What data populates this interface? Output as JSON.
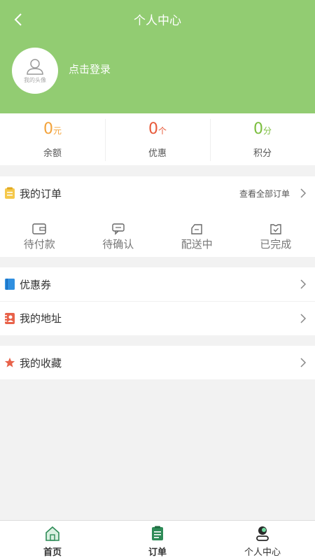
{
  "header": {
    "title": "个人中心",
    "avatar_label": "我的头像",
    "login_text": "点击登录",
    "bg_color": "#92cc72"
  },
  "stats": [
    {
      "value": "0",
      "unit": "元",
      "label": "余额",
      "color": "#f3a33b"
    },
    {
      "value": "0",
      "unit": "个",
      "label": "优惠",
      "color": "#e85a3a"
    },
    {
      "value": "0",
      "unit": "分",
      "label": "积分",
      "color": "#7cbe3f"
    }
  ],
  "orders": {
    "title": "我的订单",
    "view_all": "查看全部订单",
    "items": [
      {
        "label": "待付款",
        "icon": "wallet-icon"
      },
      {
        "label": "待确认",
        "icon": "chat-confirm-icon"
      },
      {
        "label": "配送中",
        "icon": "delivery-icon"
      },
      {
        "label": "已完成",
        "icon": "completed-icon"
      }
    ]
  },
  "menu": {
    "coupons": "优惠券",
    "address": "我的地址",
    "favorites": "我的收藏"
  },
  "tabbar": {
    "home": "首页",
    "orders": "订单",
    "profile": "个人中心",
    "active": "profile"
  }
}
